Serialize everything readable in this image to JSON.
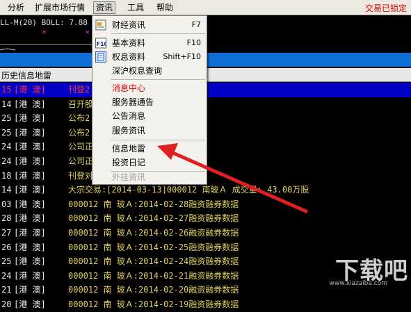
{
  "menubar": {
    "items": [
      "分析",
      "扩展市场行情",
      "资讯",
      "工具",
      "帮助"
    ],
    "status": "交易已锁定"
  },
  "indicator": {
    "text": "LL-M(20)  BOLL: 7.88  U"
  },
  "panel": {
    "title": "历史信息地雷"
  },
  "rows": [
    {
      "day": "15",
      "code": "[港  澳]",
      "text": "刊登2"
    },
    {
      "day": "14",
      "code": "[港  澳]",
      "text": "召开股"
    },
    {
      "day": "25",
      "code": "[港  澳]",
      "text": "公布2"
    },
    {
      "day": "25",
      "code": "[港  澳]",
      "text": "公布2"
    },
    {
      "day": "24",
      "code": "[港  澳]",
      "text": "公司正"
    },
    {
      "day": "24",
      "code": "[港  澳]",
      "text": "公司正"
    },
    {
      "day": "18",
      "code": "[港  澳]",
      "text": "刊登对"
    },
    {
      "day": "14",
      "code": "[港  澳]",
      "text": "大宗交易:[2014-03-13]000012 南玻Ａ 成交量: 43.00万股"
    },
    {
      "day": "03",
      "code": "[港  澳]",
      "text": "000012 南  玻Ａ:2014-02-28融资融券数据"
    },
    {
      "day": "28",
      "code": "[港  澳]",
      "text": "000012 南  玻Ａ:2014-02-27融资融券数据"
    },
    {
      "day": "27",
      "code": "[港  澳]",
      "text": "000012 南  玻Ａ:2014-02-26融资融券数据"
    },
    {
      "day": "26",
      "code": "[港  澳]",
      "text": "000012 南  玻Ａ:2014-02-25融资融券数据"
    },
    {
      "day": "25",
      "code": "[港  澳]",
      "text": "000012 南  玻Ａ:2014-02-24融资融券数据"
    },
    {
      "day": "24",
      "code": "[港  澳]",
      "text": "000012 南  玻Ａ:2014-02-21融资融券数据"
    },
    {
      "day": "21",
      "code": "[港  澳]",
      "text": "000012 南  玻Ａ:2014-02-20融资融券数据"
    },
    {
      "day": "20",
      "code": "[港  澳]",
      "text": "000012 南  玻Ａ:2014-02-19融资融券数据"
    }
  ],
  "menu": {
    "items": [
      {
        "label": "财经资讯",
        "shortcut": "F7"
      },
      {
        "label": "基本资料",
        "shortcut": "F10"
      },
      {
        "label": "权息资料",
        "shortcut": "Shift+F10"
      },
      {
        "label": "深沪权息查询",
        "shortcut": ""
      },
      {
        "label": "消息中心",
        "shortcut": ""
      },
      {
        "label": "服务器通告",
        "shortcut": ""
      },
      {
        "label": "公告消息",
        "shortcut": ""
      },
      {
        "label": "服务资讯",
        "shortcut": ""
      },
      {
        "label": "信息地雷",
        "shortcut": ""
      },
      {
        "label": "投资日记",
        "shortcut": ""
      },
      {
        "label": "外挂资讯",
        "shortcut": ""
      }
    ]
  },
  "watermark": {
    "text": "下载吧",
    "url": "www.xiazaiba.com"
  }
}
